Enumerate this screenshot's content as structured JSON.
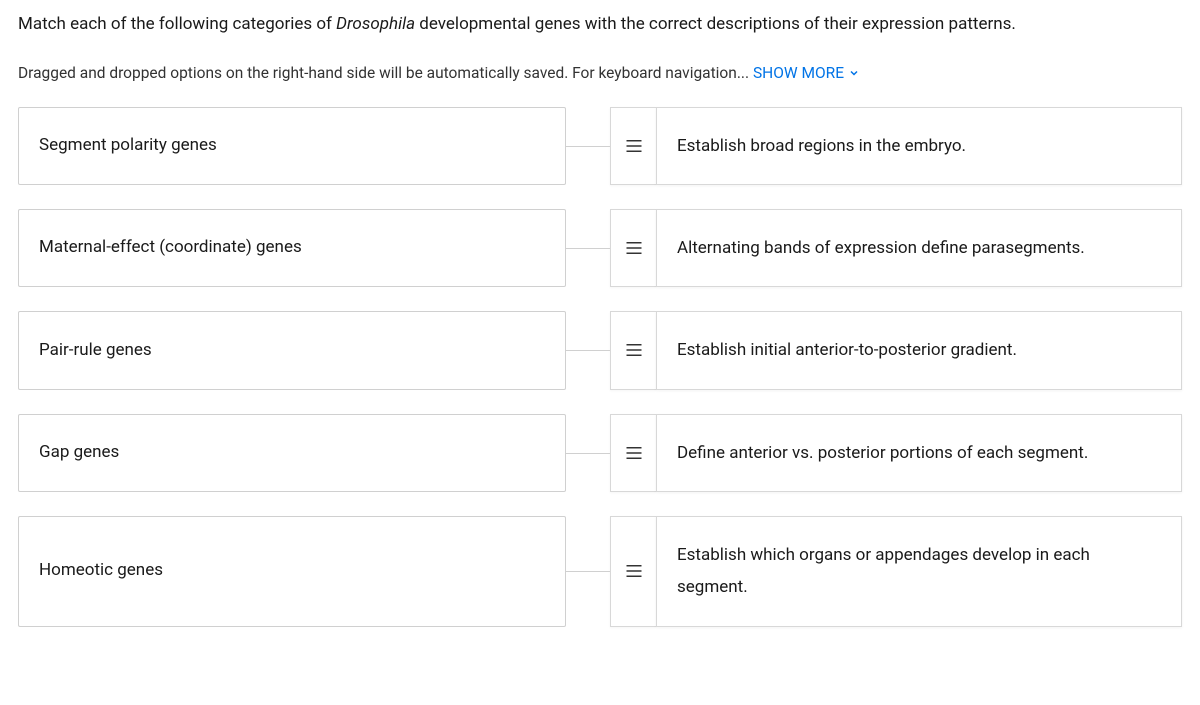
{
  "question": {
    "prefix": "Match each of the following categories of ",
    "italic": "Drosophila",
    "suffix": " developmental genes with the correct descriptions of their expression patterns."
  },
  "instructions": {
    "text": "Dragged and dropped options on the right-hand side will be automatically saved. For keyboard navigation... ",
    "show_more_label": "SHOW MORE"
  },
  "rows": [
    {
      "left": "Segment polarity genes",
      "right": "Establish broad regions in the embryo."
    },
    {
      "left": "Maternal-effect (coordinate) genes",
      "right": "Alternating bands of expression define parasegments."
    },
    {
      "left": "Pair-rule genes",
      "right": "Establish initial anterior-to-posterior gradient."
    },
    {
      "left": "Gap genes",
      "right": "Define anterior vs. posterior portions of each segment."
    },
    {
      "left": "Homeotic genes",
      "right": "Establish which organs or appendages develop in each segment."
    }
  ]
}
